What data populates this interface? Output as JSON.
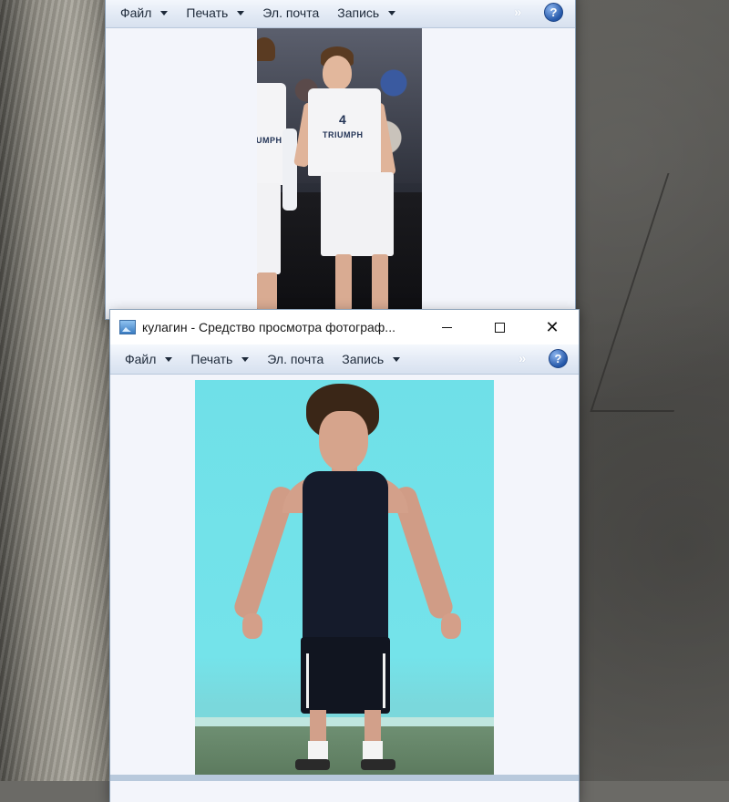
{
  "desktop": {
    "wallpaper_icon": "rock-wallpaper"
  },
  "window_back": {
    "menu": [
      {
        "label": "Файл",
        "has_dropdown": true
      },
      {
        "label": "Печать",
        "has_dropdown": true
      },
      {
        "label": "Эл. почта",
        "has_dropdown": false
      },
      {
        "label": "Запись",
        "has_dropdown": true
      }
    ],
    "more_glyph": "»",
    "help_glyph": "?",
    "photo": {
      "jersey_number": "4",
      "jersey_text": "TRIUMPH",
      "jersey_text_partial": "IUMPH"
    }
  },
  "window_front": {
    "title": "кулагин - Средство просмотра фотограф...",
    "controls": {
      "minimize_icon": "minimize-icon",
      "maximize_icon": "maximize-icon",
      "close_glyph": "✕"
    },
    "menu": [
      {
        "label": "Файл",
        "has_dropdown": true
      },
      {
        "label": "Печать",
        "has_dropdown": true
      },
      {
        "label": "Эл. почта",
        "has_dropdown": false
      },
      {
        "label": "Запись",
        "has_dropdown": true
      }
    ],
    "more_glyph": "»",
    "help_glyph": "?"
  },
  "colors": {
    "menubar_top": "#f5f8fd",
    "menubar_bottom": "#d7e1ef",
    "viewer_bg": "#f3f5fb",
    "help_blue": "#2457a8",
    "photo_wall": "#74e3ea"
  }
}
